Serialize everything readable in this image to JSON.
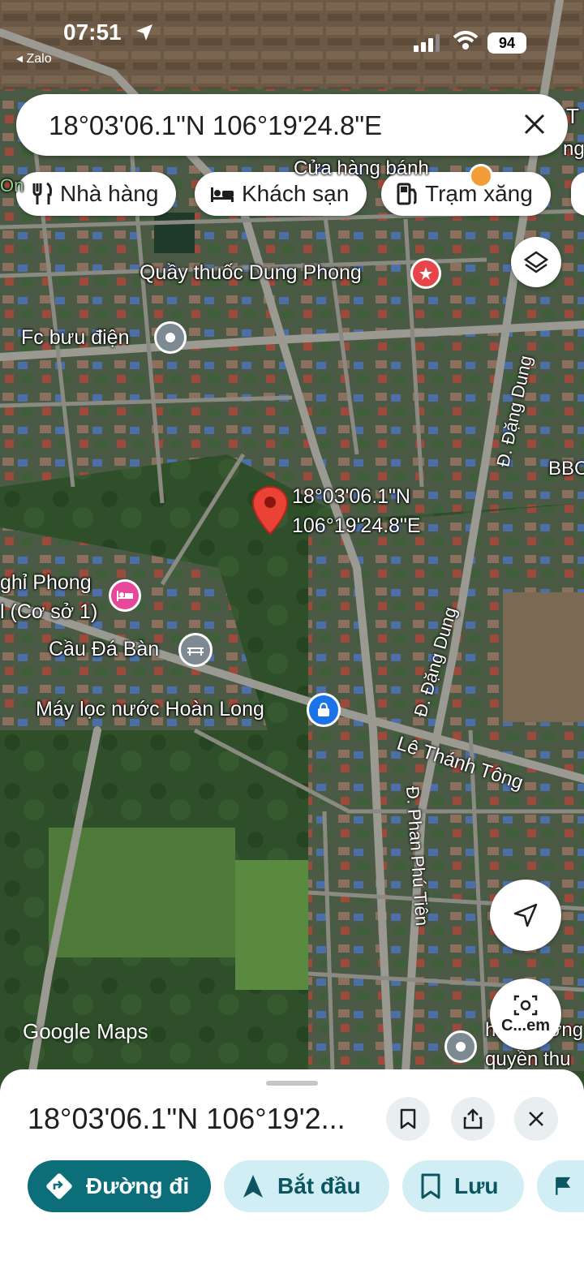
{
  "status_bar": {
    "time": "07:51",
    "back_app": "◂ Zalo",
    "battery": "94"
  },
  "search": {
    "query": "18°03'06.1\"N 106°19'24.8\"E"
  },
  "chips": [
    {
      "label": "Nhà hàng",
      "icon": "restaurant-icon"
    },
    {
      "label": "Khách sạn",
      "icon": "hotel-icon"
    },
    {
      "label": "Trạm xăng",
      "icon": "gas-station-icon"
    }
  ],
  "map": {
    "labels": {
      "pharmacy": "Quầy thuốc Dung Phong",
      "post_office": "Fc bưu điện",
      "bakery": "Cửa hàng bánh",
      "guesthouse_line1": "ghỉ Phong",
      "guesthouse_line2": "l (Cơ sở 1)",
      "bridge": "Cầu Đá Bàn",
      "water_filter": "Máy lọc nước Hoàn Long",
      "bbc": "BBC",
      "right_partial_1": "hội... mờng",
      "right_partial_2": "quyền thu",
      "partial_t": "T",
      "partial_ng": "ng",
      "partial_on": "On"
    },
    "pin": {
      "lat": "18°03'06.1\"N",
      "lng": "106°19'24.8\"E"
    },
    "streets": {
      "dang_dung_top": "Đ. Đặng Dung",
      "dang_dung_mid": "Đ. Đặng Dung",
      "le_thanh_tong": "Lê Thánh Tông",
      "phan_phu_tien": "Đ. Phan Phú Tiên"
    },
    "attribution": "Google Maps",
    "lens_label": "C...em"
  },
  "sheet": {
    "title": "18°03'06.1\"N 106°19'2...",
    "actions": {
      "directions": "Đường đi",
      "start": "Bắt đầu",
      "save": "Lưu"
    }
  },
  "colors": {
    "primary": "#0b6e79",
    "secondary_bg": "#d1eef4",
    "pin_red": "#ea4335",
    "hotel_pink": "#e8489a",
    "shop_blue": "#1a73e8"
  }
}
